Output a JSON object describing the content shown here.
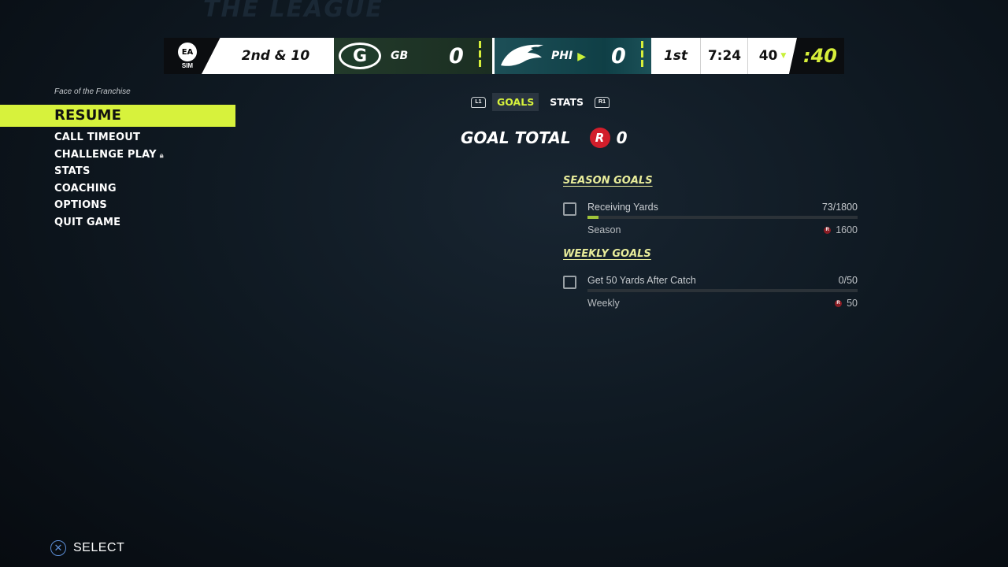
{
  "header": {
    "watermark": "THE LEAGUE"
  },
  "scoreboard": {
    "brand": "EA",
    "mode": "SIM",
    "down_distance": "2nd & 10",
    "home": {
      "abbr": "GB",
      "score": "0",
      "logo_letter": "G",
      "color": "#203b2a"
    },
    "away": {
      "abbr": "PHI",
      "score": "0",
      "color": "#0f4149"
    },
    "quarter": "1st",
    "clock": "7:24",
    "ball_on": "40",
    "play_clock": ":40"
  },
  "menu": {
    "mode_label": "Face of the Franchise",
    "items": [
      {
        "label": "RESUME",
        "active": true
      },
      {
        "label": "CALL TIMEOUT"
      },
      {
        "label": "CHALLENGE PLAY"
      },
      {
        "label": "STATS"
      },
      {
        "label": "COACHING"
      },
      {
        "label": "OPTIONS"
      },
      {
        "label": "QUIT GAME"
      }
    ]
  },
  "tabs": {
    "left_bumper": "L1",
    "right_bumper": "R1",
    "items": [
      {
        "label": "GOALS",
        "active": true
      },
      {
        "label": "STATS",
        "active": false
      }
    ]
  },
  "goal_total": {
    "label": "GOAL TOTAL",
    "icon_letter": "R",
    "value": "0"
  },
  "season_goals": {
    "title": "SEASON GOALS",
    "items": [
      {
        "name": "Receiving Yards",
        "progress": "73/1800",
        "fraction": 0.0406,
        "type": "Season",
        "reward": "1600"
      }
    ]
  },
  "weekly_goals": {
    "title": "WEEKLY GOALS",
    "items": [
      {
        "name": "Get 50 Yards After Catch",
        "progress": "0/50",
        "fraction": 0,
        "type": "Weekly",
        "reward": "50"
      }
    ]
  },
  "footer": {
    "select_label": "SELECT"
  },
  "colors": {
    "accent": "#d7f23c",
    "reward_red": "#d21e2b"
  }
}
